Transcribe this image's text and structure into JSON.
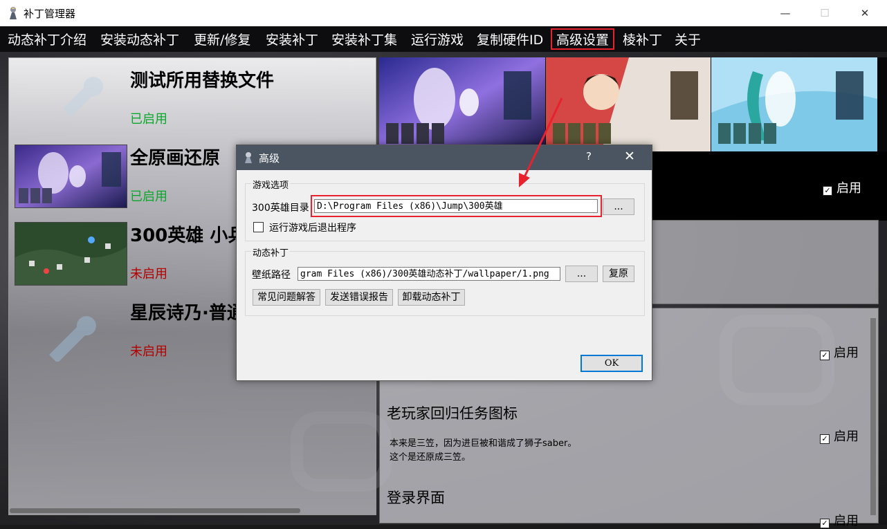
{
  "window": {
    "title": "补丁管理器",
    "minimize_glyph": "—",
    "maximize_glyph": "☐",
    "close_glyph": "✕"
  },
  "menu": {
    "items": [
      {
        "label": "动态补丁介绍"
      },
      {
        "label": "安装动态补丁"
      },
      {
        "label": "更新/修复"
      },
      {
        "label": "安装补丁"
      },
      {
        "label": "安装补丁集"
      },
      {
        "label": "运行游戏"
      },
      {
        "label": "复制硬件ID"
      },
      {
        "label": "高级设置",
        "highlighted": true
      },
      {
        "label": "棱补丁"
      },
      {
        "label": "关于"
      }
    ]
  },
  "patches": [
    {
      "title": "测试所用替换文件",
      "status": "已启用",
      "enabled": true,
      "thumb": "none"
    },
    {
      "title": "全原画还原",
      "status": "已启用",
      "enabled": true,
      "thumb": "anime-art"
    },
    {
      "title": "300英雄 小兵",
      "status": "未启用",
      "enabled": false,
      "thumb": "game-map"
    },
    {
      "title": "星辰诗乃·普通",
      "status": "未启用",
      "enabled": false,
      "thumb": "none"
    }
  ],
  "right": {
    "top_enable_label": "启用",
    "items": [
      {
        "title": "",
        "desc_lines": [],
        "enable_label": "启用",
        "checked": true
      },
      {
        "title": "老玩家回归任务图标",
        "desc_lines": [
          "本来是三笠，因为进巨被和谐成了狮子saber。",
          "这个是还原成三笠。"
        ],
        "enable_label": "启用",
        "checked": true
      },
      {
        "title": "登录界面",
        "desc_lines": [],
        "enable_label": "启用",
        "checked": true
      }
    ]
  },
  "dialog": {
    "title": "高级",
    "help_glyph": "?",
    "close_glyph": "✕",
    "game_group_label": "游戏选项",
    "game_dir_label": "300英雄目录",
    "game_dir_value": "D:\\Program Files (x86)\\Jump\\300英雄",
    "browse_label": "...",
    "exit_after_run_label": "运行游戏后退出程序",
    "exit_after_run_checked": false,
    "dyn_group_label": "动态补丁",
    "wallpaper_label": "壁纸路径",
    "wallpaper_value": "gram Files (x86)/300英雄动态补丁/wallpaper/1.png",
    "wallpaper_browse_label": "...",
    "restore_label": "复原",
    "faq_label": "常见问题解答",
    "report_label": "发送错误报告",
    "uninstall_label": "卸载动态补丁",
    "ok_label": "OK"
  },
  "colors": {
    "highlight": "#e8212d",
    "enabled_green": "#0aa82a",
    "disabled_red": "#b30000",
    "dialog_title_bg": "#4b5562"
  }
}
